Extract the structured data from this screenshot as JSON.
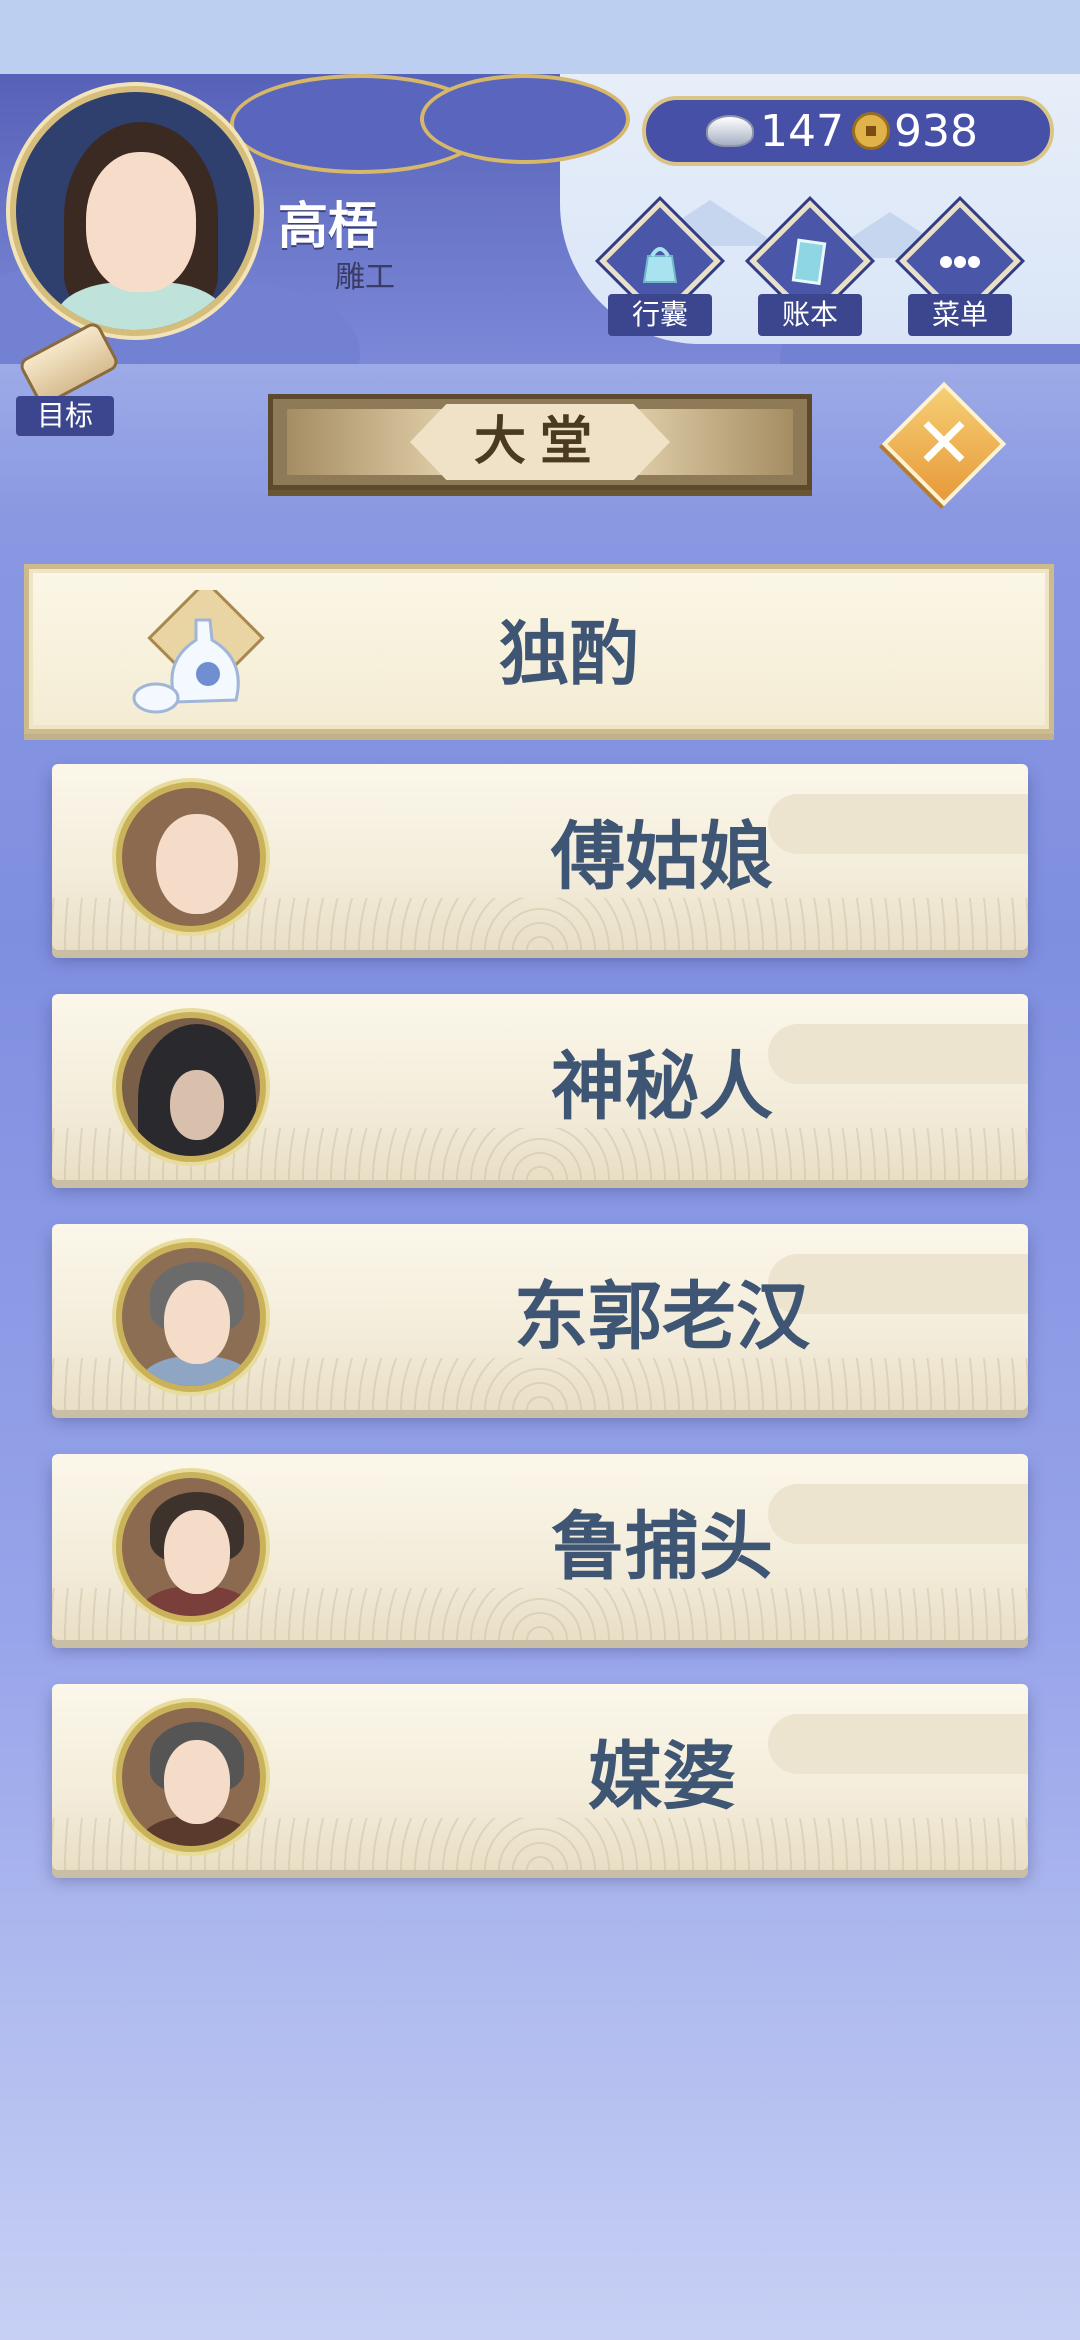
{
  "player": {
    "name": "高梧",
    "role": "雕工"
  },
  "currency": {
    "silver": "147",
    "coins": "938"
  },
  "nav": {
    "bag": "行囊",
    "ledger": "账本",
    "menu": "菜单"
  },
  "goal": "目标",
  "scene_title": "大堂",
  "featured": {
    "label": "独酌",
    "icon": "wine-vase-icon"
  },
  "characters": [
    {
      "name": "傅姑娘",
      "avatar": "blank-avatar"
    },
    {
      "name": "神秘人",
      "avatar": "hooded-figure"
    },
    {
      "name": "东郭老汉",
      "avatar": "old-man"
    },
    {
      "name": "鲁捕头",
      "avatar": "constable"
    },
    {
      "name": "媒婆",
      "avatar": "matchmaker"
    }
  ],
  "colors": {
    "accent_gold": "#d5bd7c",
    "banner_brown": "#8f7a57",
    "label_blue": "#3f5574",
    "close_orange": "#e79a3a"
  }
}
